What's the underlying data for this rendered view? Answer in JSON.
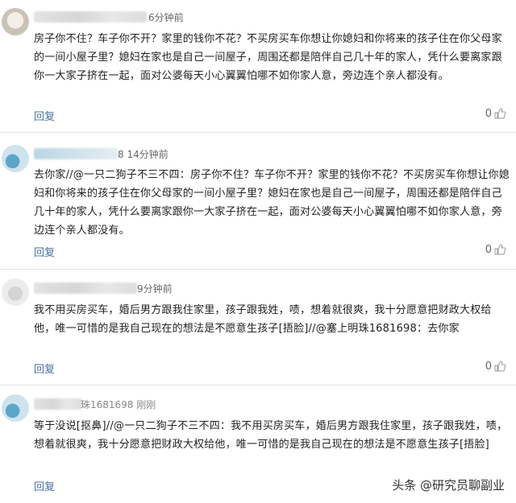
{
  "comments": [
    {
      "time": "6分钟前",
      "text": "房子你不住？车子你不开？家里的钱你不花？不买房买车你想让你媳妇和你将来的孩子住在你父母家的一间小屋子里？媳妇在家也是自己一间屋子，周围还都是陪伴自己几十年的家人，凭什么要离家跟你一大家子挤在一起，面对公婆每天小心翼翼怕哪不如你家人意，旁边连个亲人都没有。",
      "reply": "回复",
      "likes": "0"
    },
    {
      "time": "8 14分钟前",
      "text": "去你家//@一只二狗子不三不四：房子你不住？车子你不开？家里的钱你不花？不买房买车你想让你媳妇和你将来的孩子住在你父母家的一间小屋子里？媳妇在家也是自己一间屋子，周围还都是陪伴自己几十年的家人，凭什么要离家跟你一大家子挤在一起，面对公婆每天小心翼翼怕哪不如你家人意，旁边连个亲人都没有。",
      "reply": "回复",
      "likes": "0"
    },
    {
      "time": "9分钟前",
      "text": "我不用买房买车，婚后男方跟我住家里，孩子跟我姓，啧，想着就很爽，我十分愿意把财政大权给他，唯一可惜的是我自己现在的想法是不愿意生孩子[捂脸]//@塞上明珠1681698：去你家",
      "reply": "回复",
      "likes": "0"
    },
    {
      "time": "珠1681698 刚刚",
      "text": "等于没说[抠鼻]//@一只二狗子不三不四：我不用买房买车，婚后男方跟我住家里，孩子跟我姓，啧，想着就很爽，我十分愿意把财政大权给他，唯一可惜的是我自己现在的想法是不愿意生孩子[捂脸]",
      "reply": "回复",
      "likes": ""
    }
  ],
  "watermark": "头条 @研究员聊副业"
}
